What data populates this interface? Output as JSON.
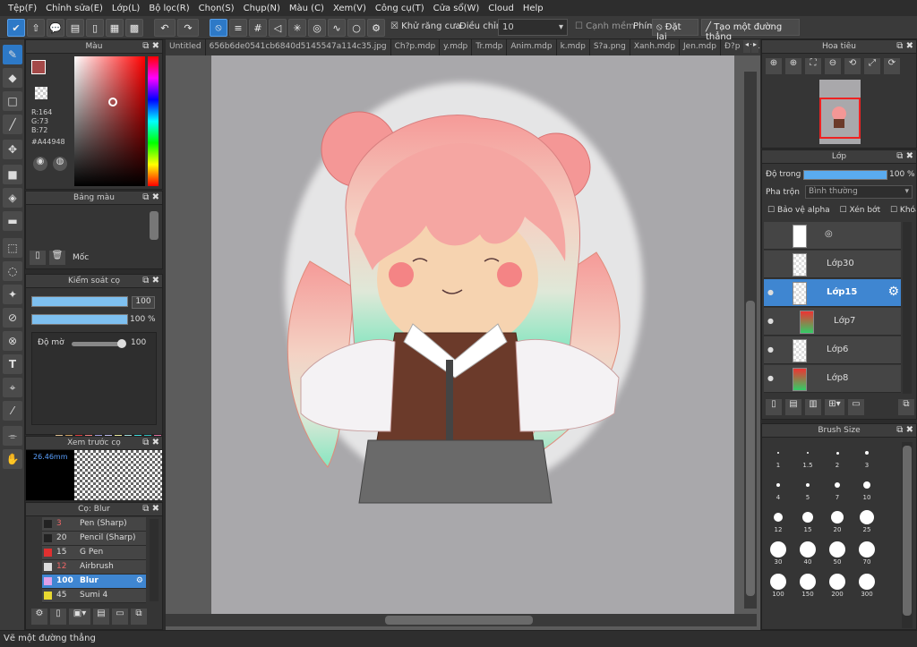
{
  "menu": [
    "Tệp(F)",
    "Chỉnh sửa(E)",
    "Lớp(L)",
    "Bộ lọc(R)",
    "Chọn(S)",
    "Chụp(N)",
    "Màu (C)",
    "Xem(V)",
    "Công cụ(T)",
    "Cửa sổ(W)",
    "Cloud",
    "Help"
  ],
  "toolbar": {
    "antialias": "Khử răng cưa",
    "adjust_label": "Điều chỉnh",
    "adjust_value": "10",
    "edge_label": "Cạnh mềm",
    "key_label": "Phím",
    "reset_label": "Đặt lại",
    "straight_label": "Tạo một đường thẳng"
  },
  "color_panel": {
    "title": "Màu",
    "r": "R:164",
    "g": "G:73",
    "b": "B:72",
    "hex": "#A44948",
    "fg": "#A44948"
  },
  "palette_panel": {
    "title": "Bảng màu",
    "moc": "Mốc"
  },
  "brush_control": {
    "title": "Kiểm soát cọ",
    "size": "100",
    "opacity": "100 %",
    "density_label": "Độ mờ",
    "density": "100"
  },
  "brush_preview": {
    "title": "Xem trước cọ",
    "size": "26.46mm"
  },
  "brush_list": {
    "title": "Cọ: Blur",
    "items": [
      {
        "size": "3",
        "name": "Pen (Sharp)",
        "color": "#222222"
      },
      {
        "size": "20",
        "name": "Pencil (Sharp)",
        "color": "#222222"
      },
      {
        "size": "15",
        "name": "G Pen",
        "color": "#e03030"
      },
      {
        "size": "12",
        "name": "Airbrush",
        "color": "#dddddd"
      },
      {
        "size": "100",
        "name": "Blur",
        "color": "#e0a0e8"
      },
      {
        "size": "45",
        "name": "Sumi 4",
        "color": "#e8d830"
      }
    ]
  },
  "tabs": [
    "Untitled",
    "656b6de0541cb6840d5145547a114c35.jpg",
    "Ch?p.mdp",
    "y.mdp",
    "Tr.mdp",
    "Anim.mdp",
    "k.mdp",
    "S?a.png",
    "Xanh.mdp",
    "Jen.mdp",
    "Đ?p nha.mdp",
    "BUy.mdp"
  ],
  "navigator": {
    "title": "Hoa tiêu"
  },
  "layers": {
    "title": "Lớp",
    "opacity_label": "Độ trong",
    "opacity": "100 %",
    "blend_label": "Pha trộn",
    "blend": "Bình thường",
    "protect_alpha": "Bảo vệ alpha",
    "clipping": "Xén bớt",
    "lock": "Khóa",
    "items": [
      "Lớp30",
      "Lớp15",
      "Lớp7",
      "Lớp6",
      "Lớp8"
    ]
  },
  "brush_size": {
    "title": "Brush Size",
    "sizes": [
      "1",
      "1.5",
      "2",
      "3",
      "4",
      "5",
      "7",
      "10",
      "12",
      "15",
      "20",
      "25",
      "30",
      "40",
      "50",
      "70",
      "100",
      "150",
      "200",
      "300"
    ]
  },
  "status": "Vẽ một đường thẳng"
}
